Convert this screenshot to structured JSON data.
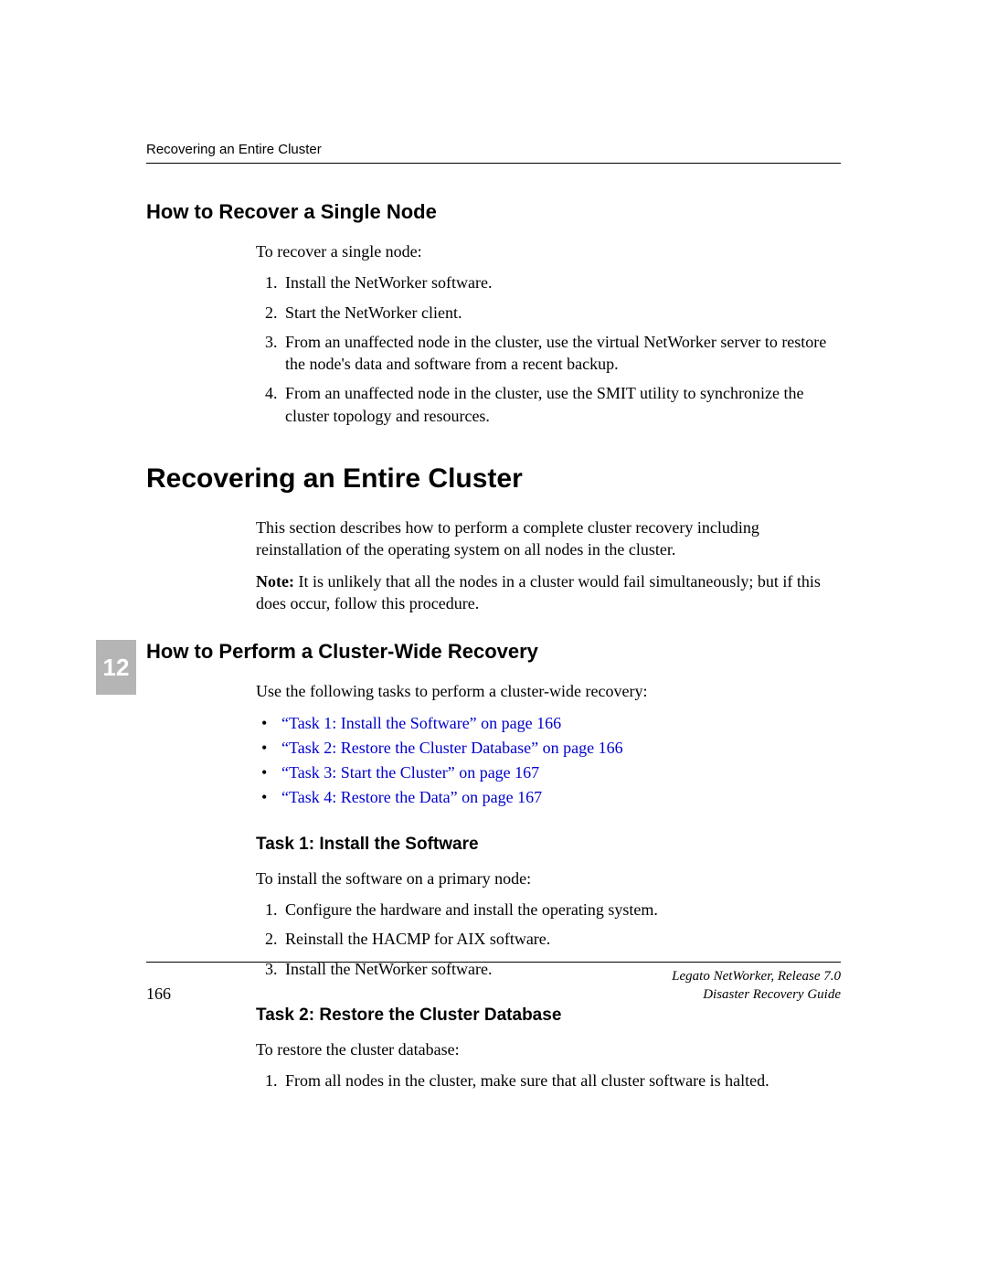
{
  "header": {
    "running": "Recovering an Entire Cluster"
  },
  "chapter_tab": "12",
  "section1": {
    "title": "How to Recover a Single Node",
    "intro": "To recover a single node:",
    "steps": [
      "Install the NetWorker software.",
      "Start the NetWorker client.",
      "From an unaffected node in the cluster, use the virtual NetWorker server to restore the node's data and software from a recent backup.",
      "From an unaffected node in the cluster, use the SMIT utility to synchronize the cluster topology and resources."
    ]
  },
  "section2": {
    "title": "Recovering an Entire Cluster",
    "para1": "This section describes how to perform a complete cluster recovery including reinstallation of the operating system on all nodes in the cluster.",
    "note_label": "Note:",
    "note_text": " It is unlikely that all the nodes in a cluster would fail simultaneously; but if this does occur, follow this procedure."
  },
  "section3": {
    "title": "How to Perform a Cluster-Wide Recovery",
    "intro": "Use the following tasks to perform a cluster-wide recovery:",
    "links": [
      "“Task 1: Install the Software” on page 166",
      "“Task 2: Restore the Cluster Database” on page 166",
      "“Task 3: Start the Cluster” on page 167",
      "“Task 4: Restore the Data” on page 167"
    ]
  },
  "task1": {
    "title": "Task 1: Install the Software",
    "intro": "To install the software on a primary node:",
    "steps": [
      "Configure the hardware and install the operating system.",
      "Reinstall the HACMP for AIX software.",
      "Install the NetWorker software."
    ]
  },
  "task2": {
    "title": "Task 2: Restore the Cluster Database",
    "intro": "To restore the cluster database:",
    "steps": [
      "From all nodes in the cluster, make sure that all cluster software is halted."
    ]
  },
  "footer": {
    "page_num": "166",
    "product": "Legato NetWorker, Release 7.0",
    "guide": "Disaster Recovery Guide"
  }
}
